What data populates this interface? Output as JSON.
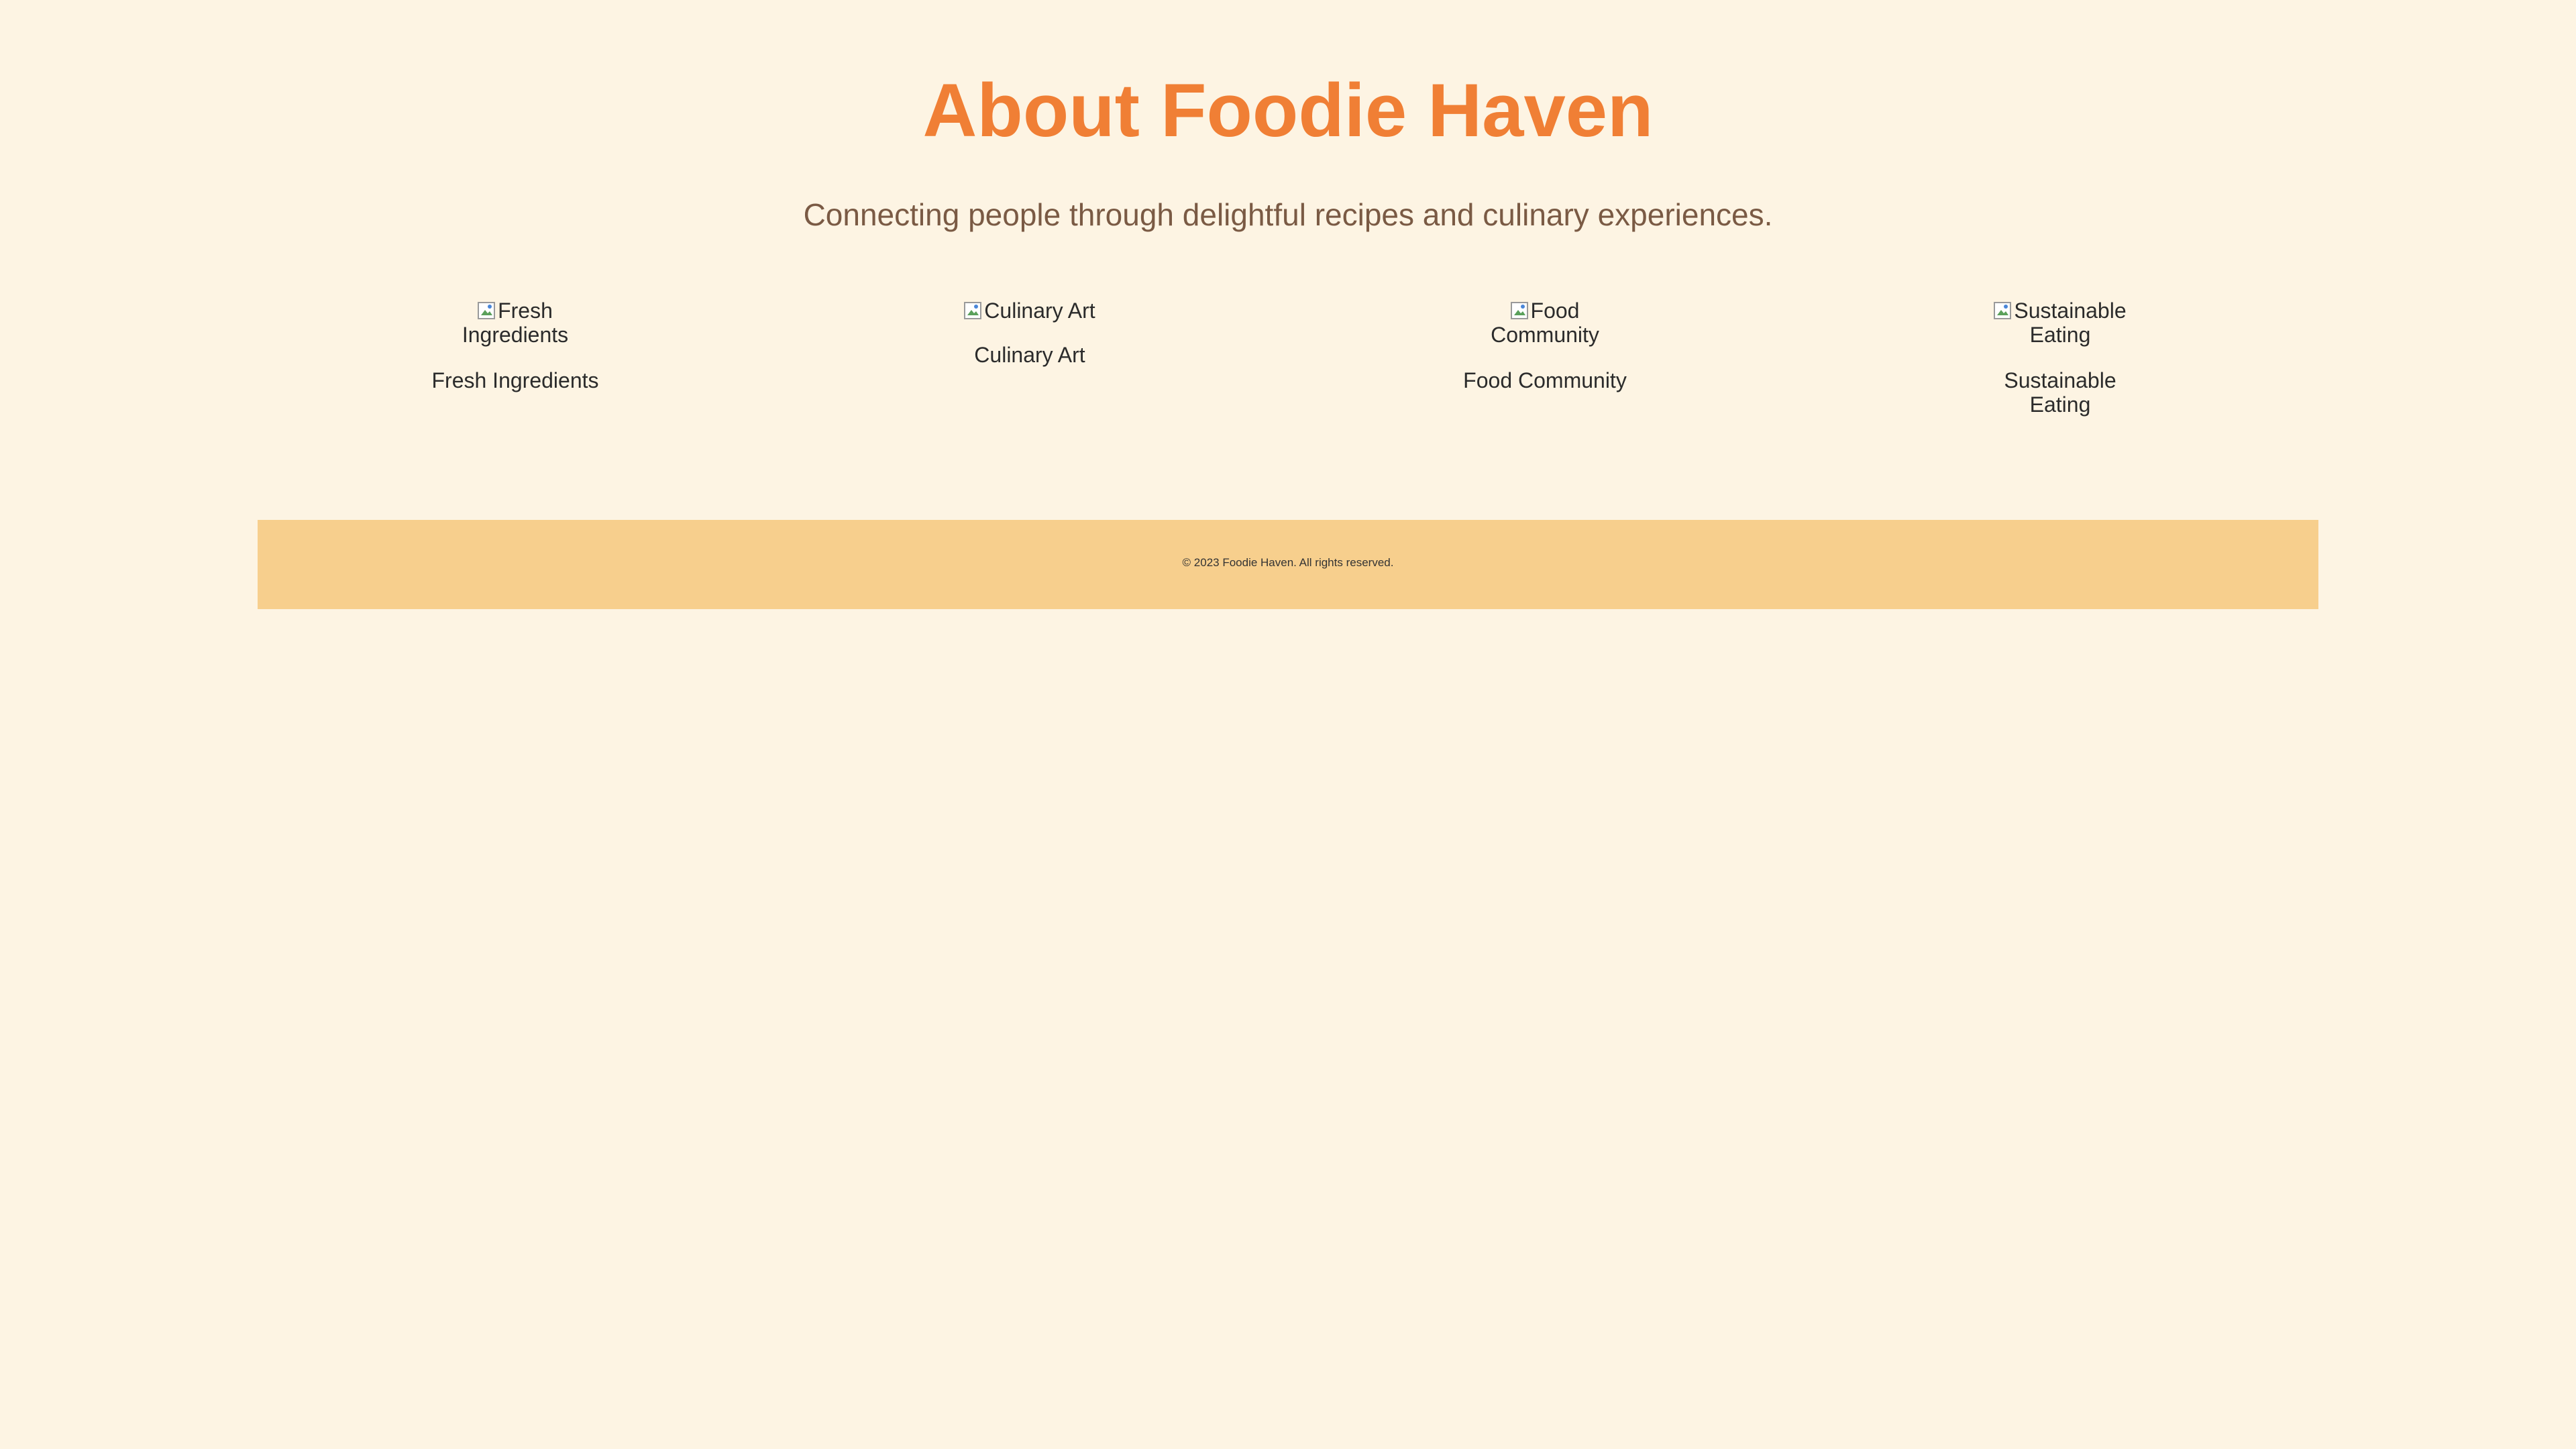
{
  "header": {
    "title": "About Foodie Haven",
    "tagline": "Connecting people through delightful recipes and culinary experiences."
  },
  "features": [
    {
      "alt": "Fresh Ingredients",
      "caption": "Fresh Ingredients",
      "icon": "broken-image-icon"
    },
    {
      "alt": "Culinary Art",
      "caption": "Culinary Art",
      "icon": "broken-image-icon"
    },
    {
      "alt": "Food Community",
      "caption": "Food Community",
      "icon": "broken-image-icon"
    },
    {
      "alt": "Sustainable Eating",
      "caption": "Sustainable Eating",
      "icon": "broken-image-icon"
    }
  ],
  "footer": {
    "text": "© 2023 Foodie Haven. All rights reserved."
  },
  "colors": {
    "background": "#fdf4e3",
    "title": "#f07f35",
    "tagline": "#7a5a44",
    "footer_background": "#f7cf8d"
  }
}
